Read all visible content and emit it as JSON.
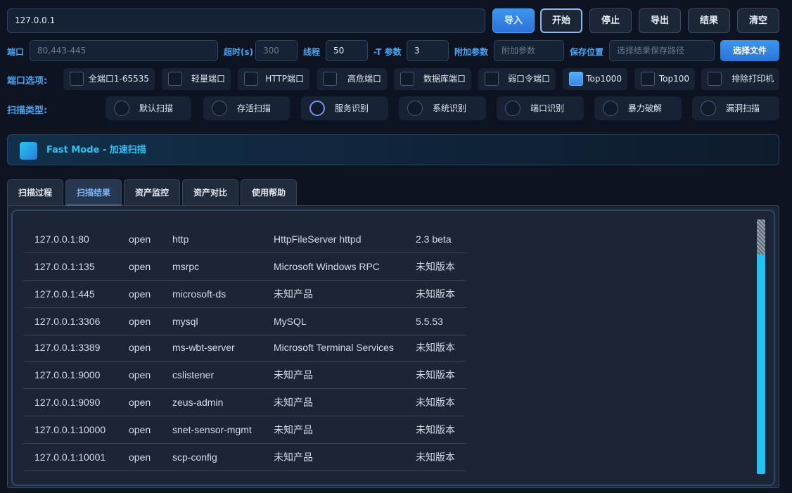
{
  "target": {
    "value": "127.0.0.1"
  },
  "toolbar": {
    "import_label": "导入",
    "start_label": "开始",
    "stop_label": "停止",
    "export_label": "导出",
    "results_label": "结果",
    "clear_label": "清空"
  },
  "params": {
    "port_label": "端口",
    "port_placeholder": "80,443-445",
    "timeout_label": "超时(s)",
    "timeout_value": "300",
    "threads_label": "线程",
    "threads_value": "50",
    "t_label": "-T 参数",
    "t_value": "3",
    "extra_label": "附加参数",
    "extra_placeholder": "附加参数",
    "save_label": "保存位置",
    "save_placeholder": "选择结果保存路径",
    "choose_file_label": "选择文件"
  },
  "port_options": {
    "label": "端口选项:",
    "items": [
      {
        "label": "全端口1-65535",
        "checked": false
      },
      {
        "label": "轻量端口",
        "checked": false
      },
      {
        "label": "HTTP端口",
        "checked": false
      },
      {
        "label": "高危端口",
        "checked": false
      },
      {
        "label": "数据库端口",
        "checked": false
      },
      {
        "label": "弱口令端口",
        "checked": false
      },
      {
        "label": "Top1000",
        "checked": true
      },
      {
        "label": "Top100",
        "checked": false
      },
      {
        "label": "排除打印机",
        "checked": false
      }
    ]
  },
  "scan_types": {
    "label": "扫描类型:",
    "items": [
      {
        "label": "默认扫描",
        "selected": false
      },
      {
        "label": "存活扫描",
        "selected": false
      },
      {
        "label": "服务识别",
        "selected": true
      },
      {
        "label": "系统识别",
        "selected": false
      },
      {
        "label": "端口识别",
        "selected": false
      },
      {
        "label": "暴力破解",
        "selected": false
      },
      {
        "label": "漏洞扫描",
        "selected": false
      }
    ]
  },
  "mode": {
    "label": "Fast Mode - 加速扫描"
  },
  "tabs": [
    {
      "label": "扫描过程"
    },
    {
      "label": "扫描结果"
    },
    {
      "label": "资产监控"
    },
    {
      "label": "资产对比"
    },
    {
      "label": "使用帮助"
    }
  ],
  "active_tab": "扫描结果",
  "results": [
    {
      "addr": "127.0.0.1:80",
      "state": "open",
      "service": "http",
      "product": "HttpFileServer httpd",
      "version": "2.3 beta"
    },
    {
      "addr": "127.0.0.1:135",
      "state": "open",
      "service": "msrpc",
      "product": "Microsoft Windows RPC",
      "version": "未知版本"
    },
    {
      "addr": "127.0.0.1:445",
      "state": "open",
      "service": "microsoft-ds",
      "product": "未知产品",
      "version": "未知版本"
    },
    {
      "addr": "127.0.0.1:3306",
      "state": "open",
      "service": "mysql",
      "product": "MySQL",
      "version": "5.5.53"
    },
    {
      "addr": "127.0.0.1:3389",
      "state": "open",
      "service": "ms-wbt-server",
      "product": "Microsoft Terminal Services",
      "version": "未知版本"
    },
    {
      "addr": "127.0.0.1:9000",
      "state": "open",
      "service": "cslistener",
      "product": "未知产品",
      "version": "未知版本"
    },
    {
      "addr": "127.0.0.1:9090",
      "state": "open",
      "service": "zeus-admin",
      "product": "未知产品",
      "version": "未知版本"
    },
    {
      "addr": "127.0.0.1:10000",
      "state": "open",
      "service": "snet-sensor-mgmt",
      "product": "未知产品",
      "version": "未知版本"
    },
    {
      "addr": "127.0.0.1:10001",
      "state": "open",
      "service": "scp-config",
      "product": "未知产品",
      "version": "未知版本"
    }
  ]
}
